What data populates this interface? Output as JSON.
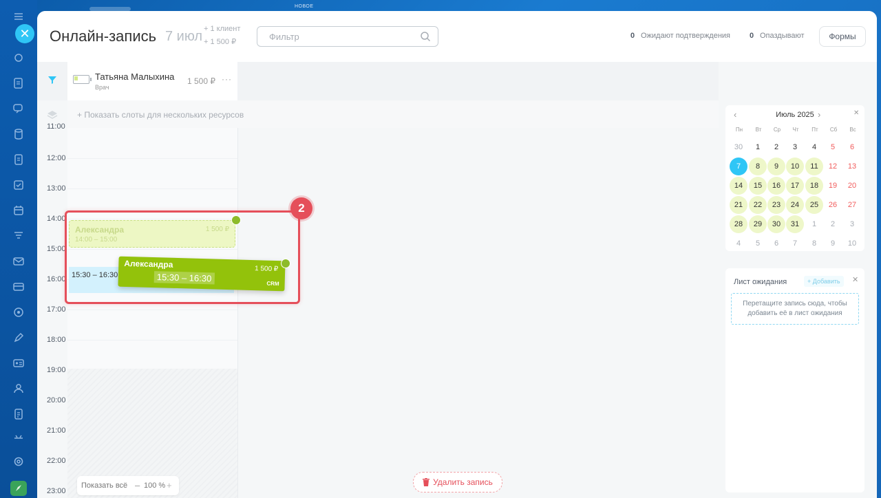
{
  "top_tag": "НОВОЕ",
  "header": {
    "title": "Онлайн-запись",
    "date": "7 июл",
    "clients": "+ 1 клиент",
    "sum": "+ 1 500 ₽",
    "filter_placeholder": "Фильтр",
    "awaiting_count": "0",
    "awaiting_label": "Ожидают подтверждения",
    "late_count": "0",
    "late_label": "Опаздывают",
    "forms_label": "Формы"
  },
  "resource": {
    "name": "Татьяна Малыхина",
    "role": "Врач",
    "price": "1 500 ₽",
    "more": "···"
  },
  "slots_label": "+ Показать слоты для нескольких ресурсов",
  "times": [
    "11:00",
    "12:00",
    "13:00",
    "14:00",
    "15:00",
    "16:00",
    "17:00",
    "18:00",
    "19:00",
    "20:00",
    "21:00",
    "22:00",
    "23:00"
  ],
  "events": {
    "ghost": {
      "name": "Александра",
      "time": "14:00 – 15:00",
      "price": "1 500 ₽"
    },
    "blue_time": "15:30 – 16:30",
    "dragged": {
      "name": "Александра",
      "time": "15:30 – 16:30",
      "price": "1 500 ₽",
      "crm": "CRM"
    }
  },
  "annotation_badge": "2",
  "zoom": {
    "show_all": "Показать всё",
    "minus": "–",
    "percent": "100 %",
    "plus": "+"
  },
  "delete_label": "Удалить запись",
  "calendar": {
    "title": "Июль 2025",
    "weekdays": [
      "Пн",
      "Вт",
      "Ср",
      "Чт",
      "Пт",
      "Сб",
      "Вс"
    ],
    "weeks": [
      [
        "30",
        "1",
        "2",
        "3",
        "4",
        "5",
        "6"
      ],
      [
        "7",
        "8",
        "9",
        "10",
        "11",
        "12",
        "13"
      ],
      [
        "14",
        "15",
        "16",
        "17",
        "18",
        "19",
        "20"
      ],
      [
        "21",
        "22",
        "23",
        "24",
        "25",
        "26",
        "27"
      ],
      [
        "28",
        "29",
        "30",
        "31",
        "1",
        "2",
        "3"
      ],
      [
        "4",
        "5",
        "6",
        "7",
        "8",
        "9",
        "10"
      ]
    ],
    "selected": "7"
  },
  "waiting_list": {
    "title": "Лист ожидания",
    "add_label": "+ Добавить",
    "drop_text": "Перетащите запись сюда, чтобы добавить её в лист ожидания"
  }
}
